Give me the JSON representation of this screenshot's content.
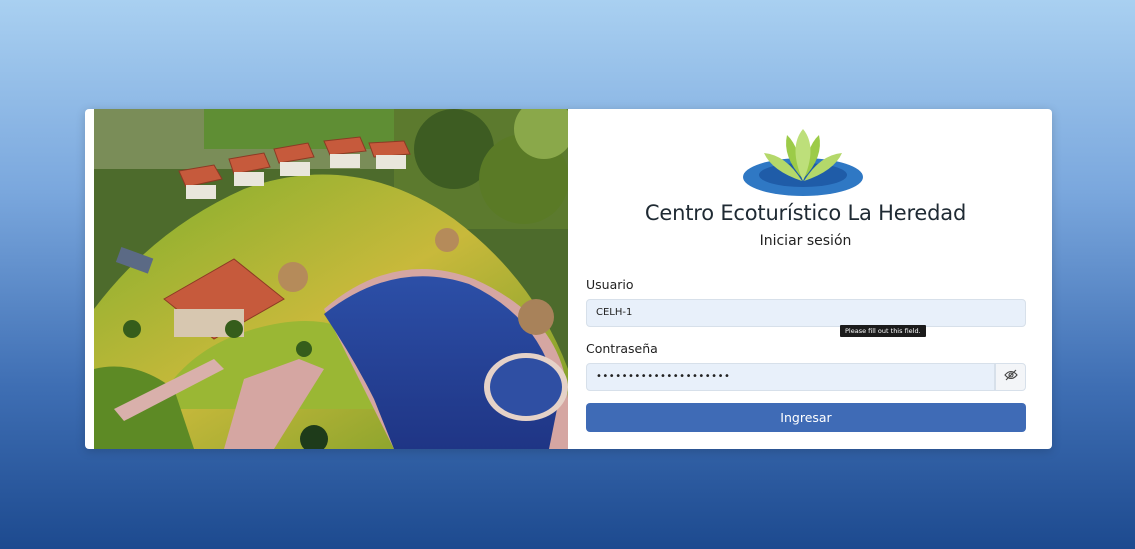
{
  "brand": {
    "title": "Centro Ecoturístico La Heredad",
    "logo_icon": "lotus-logo-icon"
  },
  "login": {
    "heading": "Iniciar sesión",
    "username_label": "Usuario",
    "username_value": "CELH-1",
    "password_label": "Contraseña",
    "password_masked": "•••••••••••••••••••••",
    "toggle_icon": "eye-slash-icon",
    "validation_tooltip": "Please fill out this field.",
    "submit_label": "Ingresar"
  },
  "colors": {
    "accent": "#3f6bb6",
    "input_bg": "#e8f0fa"
  }
}
